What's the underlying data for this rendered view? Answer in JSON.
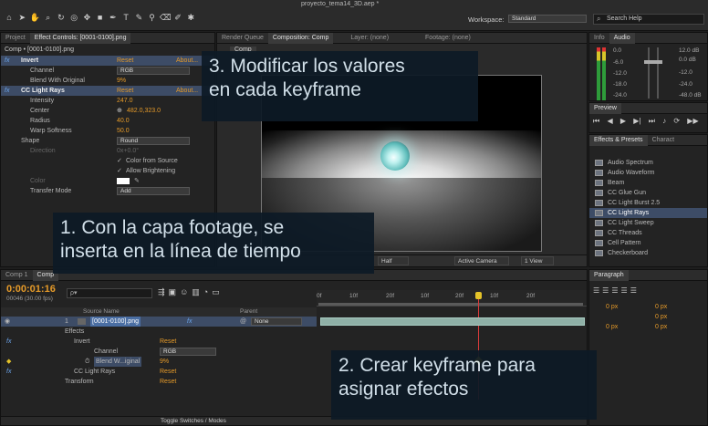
{
  "window": {
    "title": "proyecto_tema14_3D.aep *"
  },
  "toolbar": {
    "workspace_label": "Workspace:",
    "workspace_value": "Standard",
    "search_placeholder": "Search Help"
  },
  "project_panel": {
    "tabs": [
      "Project",
      "Effect Controls: [0001-0100].png"
    ],
    "header": "Comp • [0001-0100].png",
    "effects": [
      {
        "name": "Invert",
        "reset": "Reset",
        "about": "About...",
        "params": [
          {
            "label": "Channel",
            "value": "RGB",
            "type": "menu"
          },
          {
            "label": "Blend With Original",
            "value": "9%",
            "type": "num"
          }
        ]
      },
      {
        "name": "CC Light Rays",
        "reset": "Reset",
        "about": "About...",
        "params": [
          {
            "label": "Intensity",
            "value": "247.0",
            "type": "num"
          },
          {
            "label": "Center",
            "value": "482.0,323.0",
            "type": "num"
          },
          {
            "label": "Radius",
            "value": "40.0",
            "type": "num"
          },
          {
            "label": "Warp Softness",
            "value": "50.0",
            "type": "num"
          },
          {
            "label": "Shape",
            "value": "Round",
            "type": "menu"
          },
          {
            "label": "Direction",
            "value": "0x+0.0°",
            "type": "dim"
          },
          {
            "label": "",
            "value": "Color from Source",
            "type": "check"
          },
          {
            "label": "",
            "value": "Allow Brightening",
            "type": "check"
          },
          {
            "label": "Color",
            "value": "",
            "type": "color"
          },
          {
            "label": "Transfer Mode",
            "value": "Add",
            "type": "menu"
          }
        ]
      }
    ]
  },
  "viewer": {
    "tabs": [
      "Render Queue",
      "Composition: Comp",
      "Layer: (none)",
      "Footage: (none)"
    ],
    "comp_label": "Comp",
    "footer": {
      "resolution": "Half",
      "camera": "Active Camera",
      "views": "1 View"
    }
  },
  "info_audio": {
    "tabs": [
      "Info",
      "Audio"
    ],
    "db_left": [
      "0.0",
      "-6.0",
      "-12.0",
      "-18.0",
      "-24.0"
    ],
    "db_right": [
      "12.0 dB",
      "0.0 dB",
      "-12.0",
      "-24.0",
      "-48.0 dB"
    ]
  },
  "preview": {
    "title": "Preview"
  },
  "effects_presets": {
    "tabs": [
      "Effects & Presets",
      "Charact"
    ],
    "items": [
      "Audio Spectrum",
      "Audio Waveform",
      "Beam",
      "CC Glue Gun",
      "CC Light Burst 2.5",
      "CC Light Rays",
      "CC Light Sweep",
      "CC Threads",
      "Cell Pattern",
      "Checkerboard"
    ],
    "selected": "CC Light Rays"
  },
  "paragraph": {
    "title": "Paragraph",
    "fields": [
      "0 px",
      "0 px",
      "0 px",
      "0 px",
      "0 px"
    ]
  },
  "timeline": {
    "tabs": [
      "Comp 1",
      "Comp"
    ],
    "timecode": "0:00:01:16",
    "frame_info": "00046 (30.00 fps)",
    "search_placeholder": "ρ▾",
    "columns": {
      "source": "Source Name",
      "parent": "Parent"
    },
    "ruler": [
      "0f",
      "10f",
      "20f",
      "10f",
      "20f",
      "10f",
      "20f"
    ],
    "layers": [
      {
        "num": "1",
        "name": "[0001-0100].png",
        "parent": "None"
      }
    ],
    "props": [
      {
        "label": "Effects",
        "value": ""
      },
      {
        "label": "Invert",
        "value": "Reset"
      },
      {
        "label": "Channel",
        "value": "RGB"
      },
      {
        "label": "Blend W...iginal",
        "value": "9%"
      },
      {
        "label": "CC Light Rays",
        "value": "Reset"
      },
      {
        "label": "Transform",
        "value": "Reset"
      }
    ],
    "footer": "Toggle Switches / Modes"
  },
  "annotations": {
    "step3": [
      "3. Modificar los valores",
      "en cada keyframe"
    ],
    "step1": [
      "1. Con la capa  footage,  se",
      "inserta en la línea de tiempo"
    ],
    "step2": [
      "2. Crear  keyframe  para",
      "asignar efectos"
    ]
  }
}
